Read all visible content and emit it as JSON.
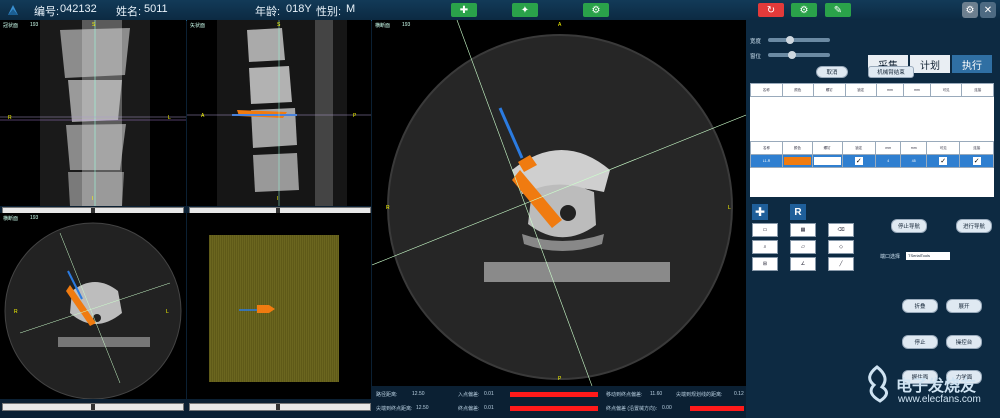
{
  "header": {
    "id_label": "编号:",
    "id_value": "042132",
    "name_label": "姓名:",
    "name_value": "5011",
    "age_label": "年龄:",
    "age_value": "018Y",
    "gender_label": "性别:",
    "gender_value": "M"
  },
  "viewports": {
    "coronal": {
      "title": "冠状面",
      "number": "193"
    },
    "sagittal": {
      "title": "矢状面",
      "number": "251"
    },
    "axial_main": {
      "title": "横断面",
      "number": "193"
    },
    "axial_small": {
      "title": "横断面",
      "number": "193"
    },
    "marker_A": "A",
    "marker_S": "S",
    "marker_L": "L",
    "marker_R": "R",
    "marker_P": "P",
    "marker_I": "I"
  },
  "right_panel": {
    "window_width_label": "宽度",
    "window_level_label": "窗位",
    "confirm_button": "取消",
    "tabs": [
      "采集",
      "计划",
      "执行"
    ],
    "robot_status_button": "机械臂结束",
    "table_headers": [
      "名称",
      "颜色",
      "螺钉",
      "锁定",
      "mm",
      "mm",
      "可见",
      "连接"
    ],
    "table_row": [
      "L1-R",
      "",
      "",
      "",
      "4",
      "45",
      "",
      ""
    ],
    "stop_nav_button": "停止导航",
    "start_nav_button": "进行导航",
    "port_label": "端口选择",
    "port_value": "TSerialTools",
    "buttons_row1": [
      "折叠",
      "展开"
    ],
    "buttons_row2": [
      "停止",
      "操控台"
    ],
    "buttons_row3": [
      "握住面",
      "力学面"
    ],
    "logo": "电子发烧友",
    "logo_url": "www.elecfans.com"
  },
  "status": {
    "entry_dist_label": "路径距离:",
    "entry_dist_value": "12.50",
    "entry_dev_label": "入点偏差:",
    "entry_dev_value": "0.01",
    "move_dev_label": "移动到终点偏差:",
    "move_dev_value": "11.60",
    "tip_dev_label": "尖端到规划线的距离:",
    "tip_dev_value": "0.12",
    "tip_dist_label": "尖端到终点距离:",
    "tip_dist_value": "12.50",
    "end_dev_label": "终点偏差:",
    "end_dev_value": "0.01",
    "end_dev2_label": "终点偏差 (沿置械方向):",
    "end_dev2_value": "0.00"
  }
}
